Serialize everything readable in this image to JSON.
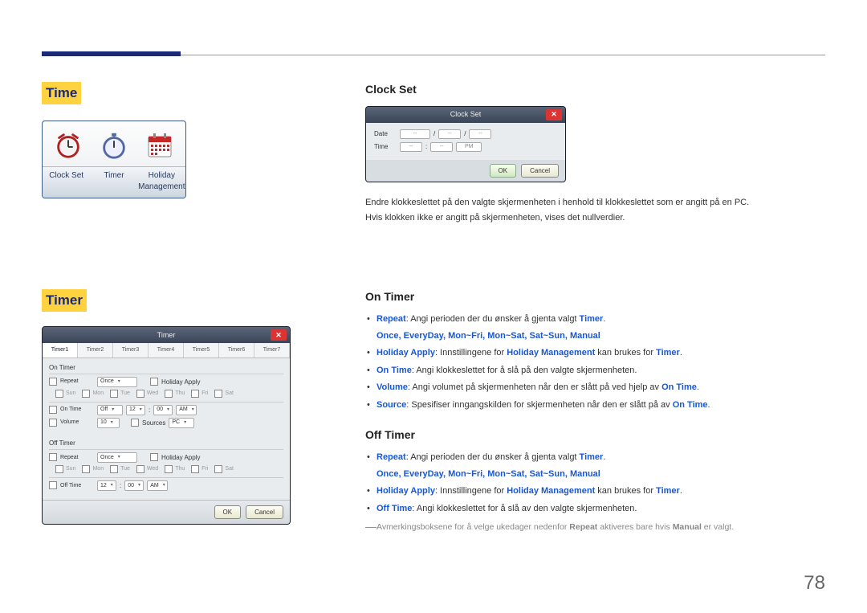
{
  "page_number": "78",
  "left": {
    "time_heading": "Time",
    "timer_heading": "Timer",
    "time_items": {
      "clock_set": "Clock Set",
      "timer": "Timer",
      "holiday": "Holiday Management"
    }
  },
  "clock_dialog": {
    "title": "Clock Set",
    "date_label": "Date",
    "time_label": "Time",
    "pm": "PM",
    "sep": "/",
    "dash": "--",
    "ok": "OK",
    "cancel": "Cancel"
  },
  "timer_dialog": {
    "title": "Timer",
    "tabs": [
      "Timer1",
      "Timer2",
      "Timer3",
      "Timer4",
      "Timer5",
      "Timer6",
      "Timer7"
    ],
    "on_timer": "On Timer",
    "off_timer": "Off Timer",
    "repeat": "Repeat",
    "once": "Once",
    "holiday_apply": "Holiday Apply",
    "on_time": "On Time",
    "off_time": "Off Time",
    "off": "Off",
    "hour": "12",
    "min": "00",
    "ampm": "AM",
    "volume": "Volume",
    "vol_val": "10",
    "sources": "Sources",
    "src_val": "PC",
    "days": [
      "Sun",
      "Mon",
      "Tue",
      "Wed",
      "Thu",
      "Fri",
      "Sat"
    ],
    "ok": "OK",
    "cancel": "Cancel"
  },
  "right": {
    "clock_set_heading": "Clock Set",
    "clock_p1": "Endre klokkeslettet på den valgte skjermenheten i henhold til klokkeslettet som er angitt på en PC.",
    "clock_p2": "Hvis klokken ikke er angitt på skjermenheten, vises det nullverdier.",
    "on_timer_heading": "On Timer",
    "off_timer_heading": "Off Timer",
    "bullets": {
      "repeat_pre": "Repeat",
      "repeat_text": ": Angi perioden der du ønsker å gjenta valgt ",
      "repeat_timer": "Timer",
      "repeat_opts": "Once, EveryDay, Mon~Fri, Mon~Sat, Sat~Sun, Manual",
      "holiday_pre": "Holiday Apply",
      "holiday_mid1": ": Innstillingene for ",
      "holiday_hm": "Holiday Management",
      "holiday_mid2": " kan brukes for ",
      "holiday_timer": "Timer",
      "ontime_pre": "On Time",
      "ontime_text": ": Angi klokkeslettet for å slå på den valgte skjermenheten.",
      "volume_pre": "Volume",
      "volume_text": ": Angi volumet på skjermenheten når den er slått på ved hjelp av ",
      "volume_ot": "On Time",
      "source_pre": "Source",
      "source_text": ": Spesifiser inngangskilden for skjermenheten når den er slått på av ",
      "source_ot": "On Time",
      "offtime_pre": "Off Time",
      "offtime_text": ": Angi klokkeslettet for å slå av den valgte skjermenheten."
    },
    "note_pre": "Avmerkingsboksene for å velge ukedager nedenfor ",
    "note_repeat": "Repeat",
    "note_mid": " aktiveres bare hvis ",
    "note_manual": "Manual",
    "note_end": " er valgt."
  }
}
